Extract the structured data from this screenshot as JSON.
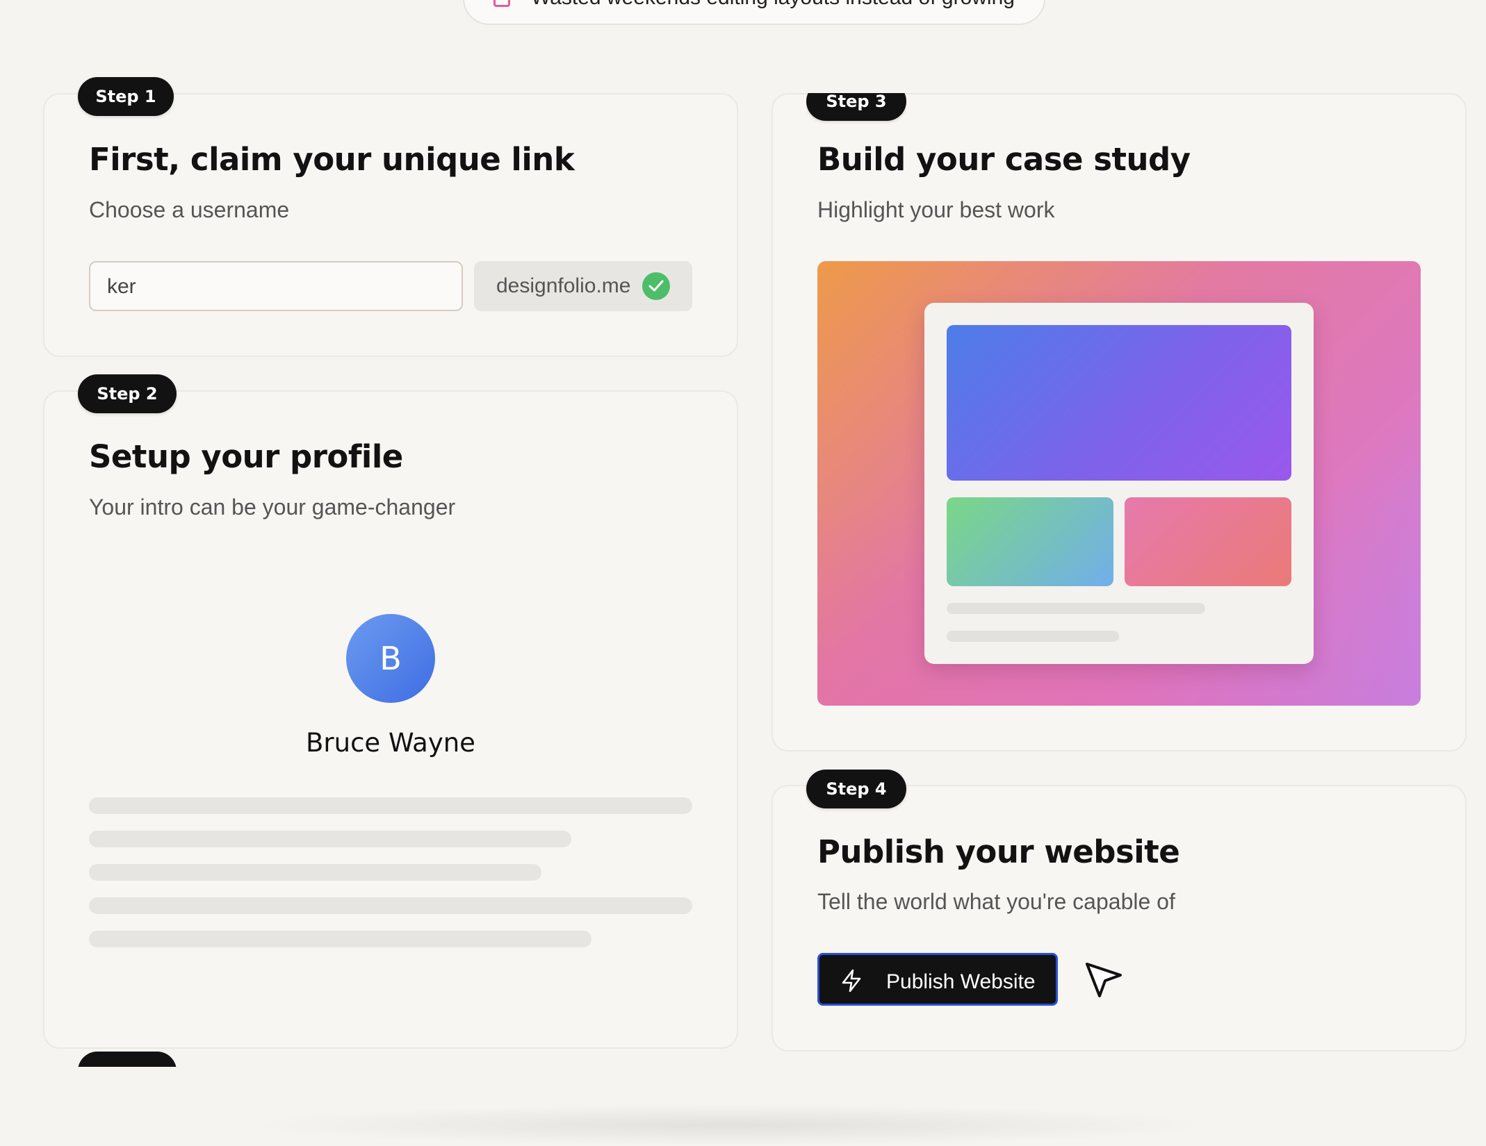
{
  "banner": {
    "text": "Wasted weekends editing layouts instead of growing"
  },
  "step1": {
    "badge": "Step 1",
    "title": "First, claim your unique link",
    "subtitle": "Choose a username",
    "username_value": "ker",
    "domain": "designfolio.me",
    "domain_status_icon": "check-circle-icon"
  },
  "step2": {
    "badge": "Step 2",
    "title": "Setup your profile",
    "subtitle": "Your intro can be your game-changer",
    "avatar_initial": "B",
    "name": "Bruce Wayne"
  },
  "step3": {
    "badge": "Step 3",
    "title": "Build your case study",
    "subtitle": "Highlight your best work"
  },
  "step4": {
    "badge": "Step 4",
    "title": "Publish your website",
    "subtitle": "Tell the world what you're capable of",
    "button_label": "Publish Website",
    "button_icon": "lightning-bolt-icon",
    "cursor_icon": "pointer-cursor-icon"
  },
  "colors": {
    "badge_bg": "#121212",
    "success": "#4dbd6a",
    "button_border": "#2a4fd8",
    "avatar": "#4f7ce8"
  }
}
